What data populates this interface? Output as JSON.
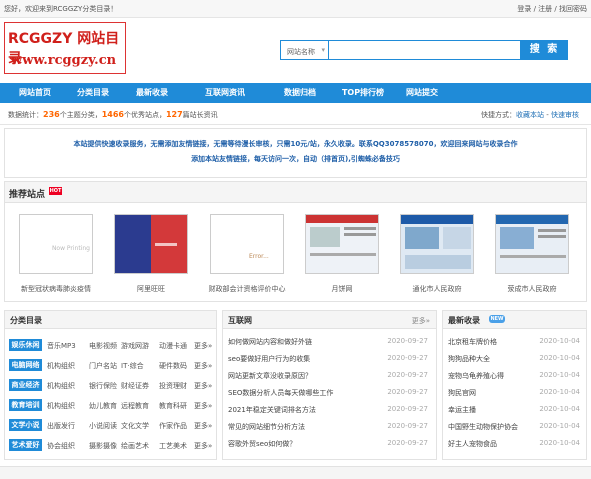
{
  "topbar": {
    "welcome": "您好，欢迎来到RCGGZY分类目录！",
    "login": "登录",
    "register": "注册",
    "find_password": "找回密码",
    "sep": "/"
  },
  "logo": {
    "title": "RCGGZY 网站目录",
    "url": "www.rcggzy.cn"
  },
  "search": {
    "select_label": "网站名称",
    "placeholder": "",
    "button": "搜 索"
  },
  "nav": {
    "items": [
      "网站首页",
      "分类目录",
      "最新收录",
      "互联网资讯",
      "数据归档",
      "TOP排行榜",
      "网站提交"
    ]
  },
  "stats": {
    "prefix": "数据统计：",
    "cat_count": "236",
    "cat_label": "个主题分类，",
    "site_count": "1466",
    "site_label": "个优秀站点，",
    "news_count": "127",
    "news_label": "篇站长资讯",
    "quick_prefix": "快捷方式：",
    "bookmark": "收藏本站",
    "dot": "-",
    "quick_audit": "快速审核"
  },
  "notice": {
    "line1": "本站提供快速收录服务，无需添加友情链接，无需等待漫长审核，只需10元/站，永久收录。联系QQ3078578070，欢迎回来网站与收录合作",
    "line2": "添加本站友情链接，每天访问一次，自动（排首页),引蜘蛛必备技巧"
  },
  "recommend": {
    "title": "推荐站点",
    "hot": "HOT",
    "sites": [
      "新型冠状病毒肺炎疫情",
      "阿里旺旺",
      "财政部会计资格评价中心",
      "月饼网",
      "通化市人民政府",
      "荥成市人民政府"
    ],
    "site_thumb_text": [
      "Now Printing",
      "",
      "Error...",
      "",
      "",
      ""
    ]
  },
  "categories": {
    "title": "分类目录",
    "more": "更多»",
    "rows": [
      {
        "tag": "娱乐休闲",
        "subs": [
          "音乐MP3",
          "电影视频",
          "游戏网游",
          "动漫卡通",
          "更多»"
        ]
      },
      {
        "tag": "电脑网络",
        "subs": [
          "机构组织",
          "门户名站",
          "IT·综合",
          "硬件数码",
          "更多»"
        ]
      },
      {
        "tag": "商业经济",
        "subs": [
          "机构组织",
          "银行保险",
          "财经证券",
          "投资理财",
          "更多»"
        ]
      },
      {
        "tag": "教育培训",
        "subs": [
          "机构组织",
          "幼儿教育",
          "远程教育",
          "教育科研",
          "更多»"
        ]
      },
      {
        "tag": "文学小说",
        "subs": [
          "出版发行",
          "小说阅读",
          "文化文学",
          "作家作品",
          "更多»"
        ]
      },
      {
        "tag": "艺术爱好",
        "subs": [
          "协会组织",
          "摄影摄像",
          "绘画艺术",
          "工艺美术",
          "更多»"
        ]
      }
    ]
  },
  "internet": {
    "title": "互联网",
    "more": "更多»",
    "items": [
      {
        "t": "如何做网站内容和做好外链",
        "d": "2020-09-27"
      },
      {
        "t": "seo要做好用户行为的收集",
        "d": "2020-09-27"
      },
      {
        "t": "网站更新文章没收录原因？",
        "d": "2020-09-27"
      },
      {
        "t": "SEO数据分析人员每天做哪些工作",
        "d": "2020-09-27"
      },
      {
        "t": "2021年稳定关键词排名方法",
        "d": "2020-09-27"
      },
      {
        "t": "常见的网站细节分析方法",
        "d": "2020-09-27"
      },
      {
        "t": "容歌外贸seo如何做？",
        "d": "2020-09-27"
      }
    ]
  },
  "latest": {
    "title": "最新收录",
    "badge": "NEW",
    "items": [
      {
        "t": "北京租车牌价格",
        "d": "2020-10-04"
      },
      {
        "t": "狗狗品种大全",
        "d": "2020-10-04"
      },
      {
        "t": "宠物乌龟养殖心得",
        "d": "2020-10-04"
      },
      {
        "t": "狗民官网",
        "d": "2020-10-04"
      },
      {
        "t": "幸运主播",
        "d": "2020-10-04"
      },
      {
        "t": "中国野生动物保护协会",
        "d": "2020-10-04"
      },
      {
        "t": "好主人宠物食品",
        "d": "2020-10-04"
      }
    ]
  },
  "colors": {
    "brand_blue": "#1f8bd8",
    "logo_red": "#d0201b",
    "count_orange": "#ff6600"
  }
}
